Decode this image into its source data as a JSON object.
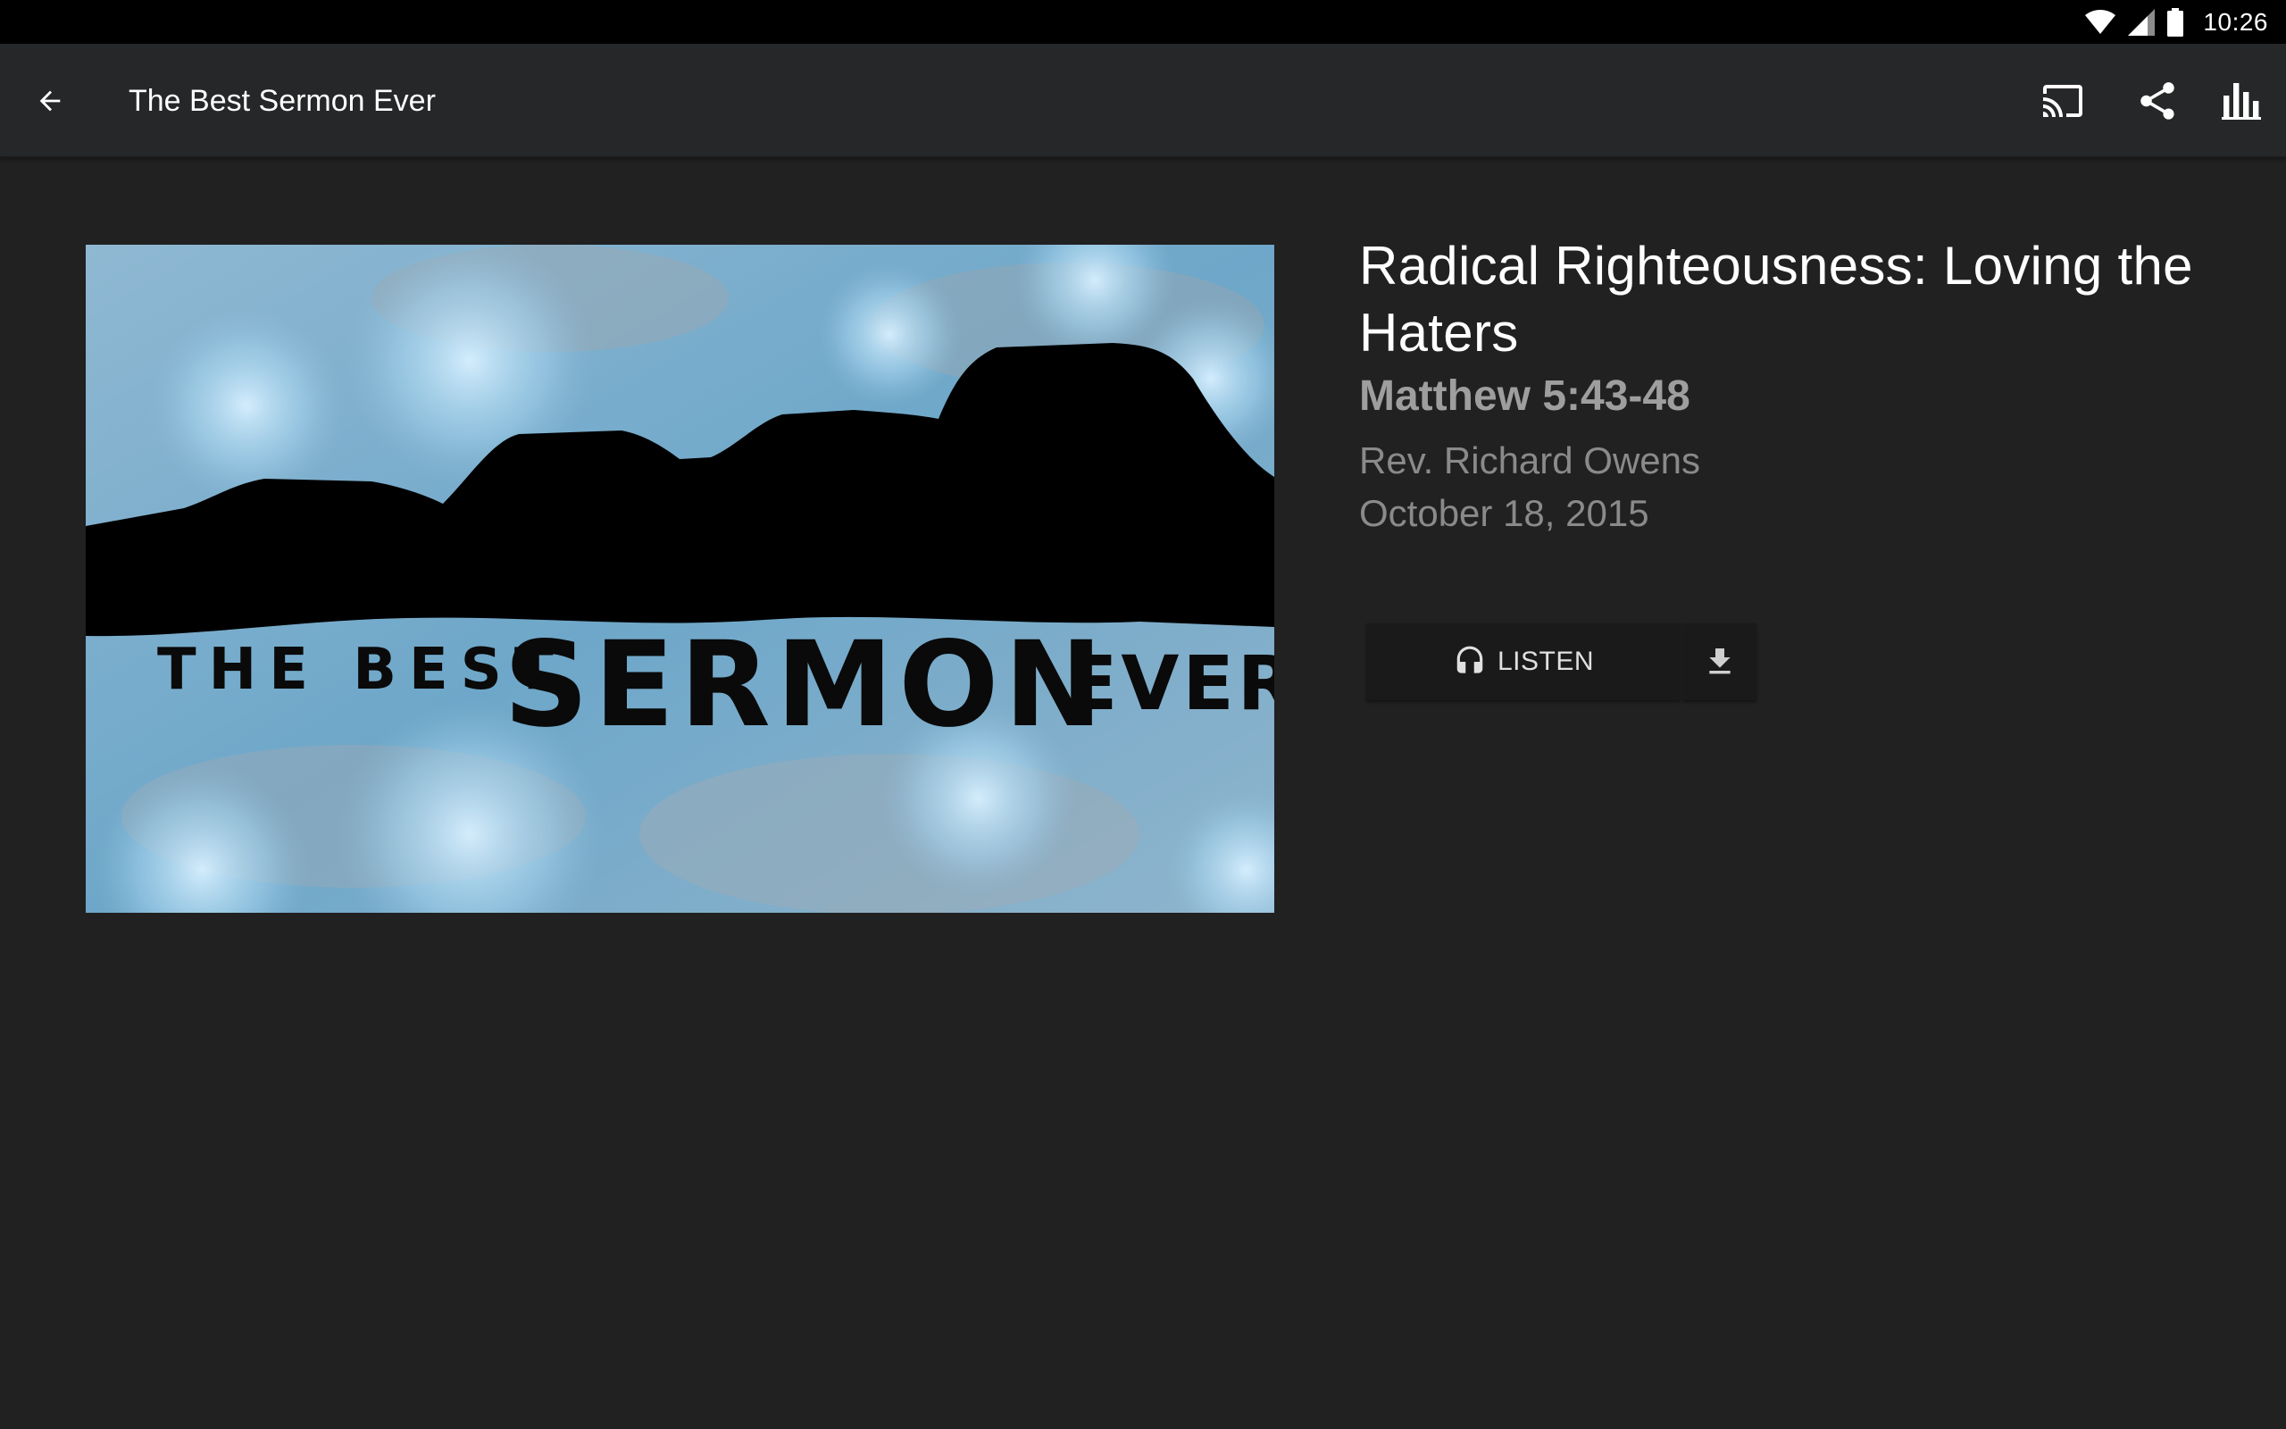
{
  "status_bar": {
    "time": "10:26",
    "icons": [
      "wifi-icon",
      "cell-signal-icon",
      "battery-icon"
    ]
  },
  "app_bar": {
    "title": "The Best Sermon Ever",
    "back_icon": "arrow-left-icon",
    "actions": [
      "cast-icon",
      "share-icon",
      "bar-chart-icon"
    ]
  },
  "sermon": {
    "artwork": {
      "line1": "THE BEST",
      "line2": "SERMON",
      "line3": "EVER"
    },
    "title": "Radical Righteousness: Loving the Haters",
    "scripture": "Matthew 5:43-48",
    "speaker": "Rev. Richard Owens",
    "date": "October 18, 2015"
  },
  "buttons": {
    "listen_label": "LISTEN",
    "listen_icon": "headphones-icon",
    "download_icon": "download-icon"
  },
  "colors": {
    "background": "#212121",
    "app_bar": "#262728",
    "status_bar": "#000000",
    "text_primary": "#ffffff",
    "text_secondary": "#8a8a8a",
    "button_bg": "#1a1a1a"
  }
}
